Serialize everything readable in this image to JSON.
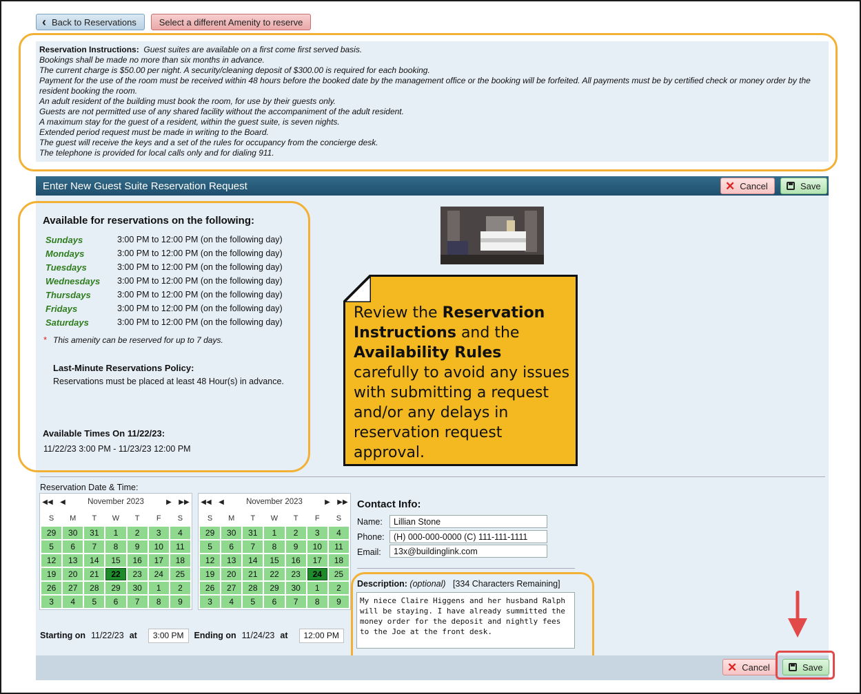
{
  "top_buttons": {
    "back_label": "Back to Reservations",
    "amenity_label": "Select a different Amenity to reserve"
  },
  "instructions": {
    "label": "Reservation Instructions:",
    "lines": [
      "Guest suites are available on a first come first served basis.",
      "Bookings shall be made no more than six months in advance.",
      "The current charge is $50.00 per night. A security/cleaning deposit of $300.00 is required for each booking.",
      "Payment for the use of the room must be received within 48 hours before the booked date by the management office or the booking will be forfeited. All payments must be by certified check or money order by the resident booking the room.",
      "An adult resident of the building must book the room, for use by their guests only.",
      "Guests are not permitted use of any shared facility without the accompaniment of the adult resident.",
      "A maximum stay for the guest of a resident, within the guest suite, is seven nights.",
      "Extended period request must be made in writing to the Board.",
      "The guest will receive the keys and a set of the rules for occupancy from the concierge desk.",
      "The telephone is provided for local calls only and for dialing 911."
    ]
  },
  "header": {
    "title": "Enter New Guest Suite Reservation Request",
    "cancel_label": "Cancel",
    "save_label": "Save"
  },
  "availability": {
    "title": "Available for reservations on the following:",
    "days": [
      {
        "day": "Sundays",
        "time": "3:00 PM to 12:00 PM (on the following day)"
      },
      {
        "day": "Mondays",
        "time": "3:00 PM to 12:00 PM (on the following day)"
      },
      {
        "day": "Tuesdays",
        "time": "3:00 PM to 12:00 PM (on the following day)"
      },
      {
        "day": "Wednesdays",
        "time": "3:00 PM to 12:00 PM (on the following day)"
      },
      {
        "day": "Thursdays",
        "time": "3:00 PM to 12:00 PM (on the following day)"
      },
      {
        "day": "Fridays",
        "time": "3:00 PM to 12:00 PM (on the following day)"
      },
      {
        "day": "Saturdays",
        "time": "3:00 PM to 12:00 PM (on the following day)"
      }
    ],
    "note": "This amenity can be reserved for up to 7 days.",
    "last_minute_title": "Last-Minute Reservations Policy:",
    "last_minute_text": "Reservations must be placed at least 48 Hour(s) in advance.",
    "times_title": "Available Times On 11/22/23:",
    "times_text": "11/22/23 3:00 PM - 11/23/23 12:00 PM"
  },
  "callout": {
    "p1": "Review the ",
    "b1": "Reservation Instructions",
    "p2": " and the ",
    "b2": "Availability Rules",
    "p3": " carefully to avoid any issues with submitting a request and/or any delays in reservation request approval."
  },
  "reservation": {
    "label": "Reservation Date & Time:",
    "calendars": [
      {
        "month": "November 2023",
        "dow": [
          "S",
          "M",
          "T",
          "W",
          "T",
          "F",
          "S"
        ],
        "days": [
          "29",
          "30",
          "31",
          "1",
          "2",
          "3",
          "4",
          "5",
          "6",
          "7",
          "8",
          "9",
          "10",
          "11",
          "12",
          "13",
          "14",
          "15",
          "16",
          "17",
          "18",
          "19",
          "20",
          "21",
          "22",
          "23",
          "24",
          "25",
          "26",
          "27",
          "28",
          "29",
          "30",
          "1",
          "2",
          "3",
          "4",
          "5",
          "6",
          "7",
          "8",
          "9"
        ],
        "selected": "22"
      },
      {
        "month": "November 2023",
        "dow": [
          "S",
          "M",
          "T",
          "W",
          "T",
          "F",
          "S"
        ],
        "days": [
          "29",
          "30",
          "31",
          "1",
          "2",
          "3",
          "4",
          "5",
          "6",
          "7",
          "8",
          "9",
          "10",
          "11",
          "12",
          "13",
          "14",
          "15",
          "16",
          "17",
          "18",
          "19",
          "20",
          "21",
          "22",
          "23",
          "24",
          "25",
          "26",
          "27",
          "28",
          "29",
          "30",
          "1",
          "2",
          "3",
          "4",
          "5",
          "6",
          "7",
          "8",
          "9"
        ],
        "selected": "24"
      }
    ],
    "starting_label": "Starting on",
    "starting_date": "11/22/23",
    "at_label": "at",
    "starting_time": "3:00 PM",
    "ending_label": "Ending on",
    "ending_date": "11/24/23",
    "ending_time": "12:00 PM"
  },
  "contact": {
    "title": "Contact Info:",
    "name_label": "Name:",
    "name_value": "Lillian Stone",
    "phone_label": "Phone:",
    "phone_value": "(H) 000-000-0000 (C) 111-111-1111",
    "email_label": "Email:",
    "email_value": "13x@buildinglink.com"
  },
  "description": {
    "label": "Description:",
    "optional": "(optional)",
    "remaining": "[334 Characters Remaining]",
    "text": "My niece Claire Higgens and her husband Ralph will be staying. I have already summitted the money order for the deposit and nightly fees to the Joe at the front desk."
  },
  "footer": {
    "cancel_label": "Cancel",
    "save_label": "Save"
  },
  "colors": {
    "accent_outline": "#f2b134",
    "header_bar": "#1f4f6d",
    "available_day": "#8ed98e",
    "selected_day": "#1e8a2a",
    "callout_fill": "#f4b921",
    "arrow": "#e24a4a"
  }
}
